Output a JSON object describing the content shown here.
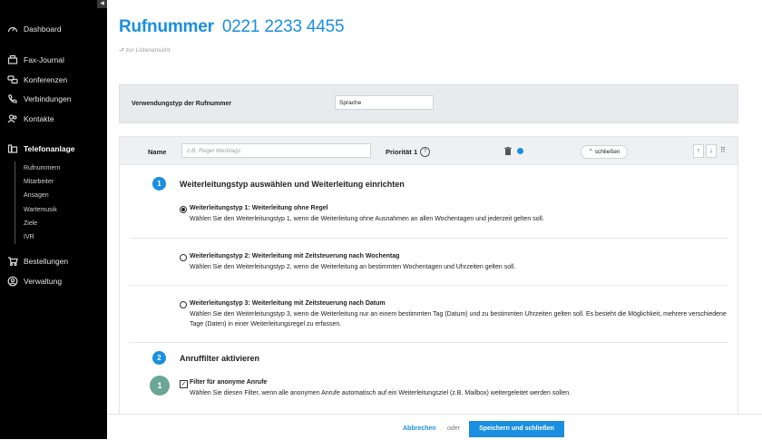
{
  "sidebar": {
    "collapse": "◀",
    "items": [
      {
        "label": "Dashboard",
        "icon": "dashboard-icon"
      },
      {
        "label": "Fax-Journal",
        "icon": "fax-icon"
      },
      {
        "label": "Konferenzen",
        "icon": "conference-icon"
      },
      {
        "label": "Verbindungen",
        "icon": "phone-icon"
      },
      {
        "label": "Kontakte",
        "icon": "contacts-icon"
      },
      {
        "label": "Telefonanlage",
        "icon": "pbx-icon"
      },
      {
        "label": "Bestellungen",
        "icon": "cart-icon"
      },
      {
        "label": "Verwaltung",
        "icon": "user-icon"
      }
    ],
    "subitems": [
      "Rufnummern",
      "Mitarbeiter",
      "Ansagen",
      "Wartemusik",
      "Ziele",
      "IVR"
    ]
  },
  "header": {
    "title": "Rufnummer",
    "number": "0221 2233 4455",
    "back_link": "⮐ zur Listenansicht"
  },
  "usage": {
    "label": "Verwendungstyp der Rufnummer",
    "value": "Sprache"
  },
  "rule": {
    "name_label": "Name",
    "name_placeholder": "z.B. Regel Werktags",
    "priority_label": "Priorität",
    "priority_value": "1",
    "help": "?",
    "close_label": "⌃ schließen",
    "up": "↑",
    "down": "↓",
    "drag": "⠿"
  },
  "section1": {
    "step": "1",
    "title": "Weiterleitungstyp auswählen und Weiterleitung einrichten",
    "options": [
      {
        "title": "Weiterleitungstyp 1: Weiterleitung ohne Regel",
        "desc": "Wählen Sie den Weiterleitungstyp 1, wenn die Weiterleitung ohne Ausnahmen an allen Wochentagen und jederzeit gelten soll.",
        "checked": true
      },
      {
        "title": "Weiterleitungstyp 2: Weiterleitung mit Zeitsteuerung nach Wochentag",
        "desc": "Wählen Sie den Weiterleitungstyp 2, wenn die Weiterleitung an bestimmten Wochentagen und Uhrzeiten gelten soll.",
        "checked": false
      },
      {
        "title": "Weiterleitungstyp 3: Weiterleitung mit Zeitsteuerung nach Datum",
        "desc": "Wählen Sie den Weiterleitungstyp 3, wenn die Weiterleitung nur an einem bestimmten Tag (Datum) und zu bestimmten Uhrzeiten gelten soll. Es besteht die Möglichkeit, mehrere verschiedene Tage (Daten) in einer Weiterleitungsregel zu erfassen.",
        "checked": false
      }
    ]
  },
  "section2": {
    "step": "2",
    "title": "Anruffilter aktivieren",
    "filter_step": "1",
    "filter_title": "Filter für anonyme Anrufe",
    "filter_desc": "Wählen Sie diesen Filter, wenn alle anonymen Anrufe automatisch auf ein Weiterleitungsziel (z.B. Mailbox) weitergeleitet werden sollen.",
    "filter_checked": "✓"
  },
  "footer": {
    "cancel": "Abbrechen",
    "or": "oder",
    "save": "Speichern und schließen"
  },
  "colors": {
    "accent": "#1a8fe0",
    "filter_badge": "#6aa596",
    "sidebar": "#000000"
  }
}
